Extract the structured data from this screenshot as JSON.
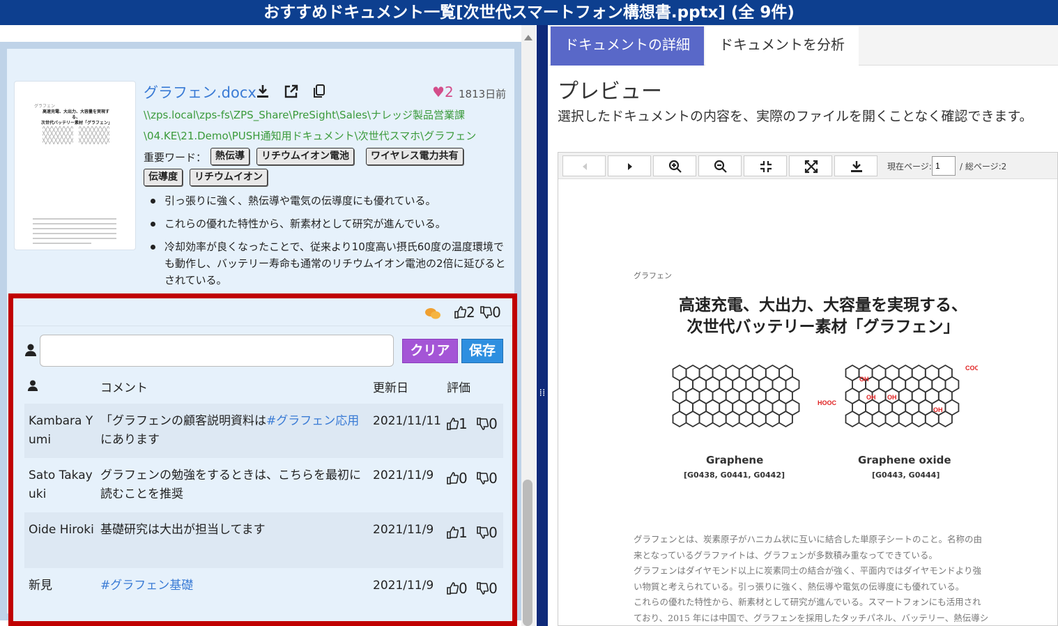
{
  "window": {
    "title": "おすすめドキュメント一覧[次世代スマートフォン構想書.pptx] (全 9件)"
  },
  "document": {
    "title": "グラフェン.docx",
    "likes": "2",
    "age": "1813日前",
    "path_line1": "\\\\zps.local\\zps-fs\\ZPS_Share\\PreSight\\Sales\\ナレッジ製品営業課",
    "path_line2": "\\04.KE\\21.Demo\\PUSH通知用ドキュメント\\次世代スマホ\\グラフェン",
    "keywords_label": "重要ワード：",
    "keywords": [
      "熱伝導",
      "リチウムイオン電池",
      "ワイヤレス電力共有",
      "伝導度",
      "リチウムイオン"
    ],
    "bullets": [
      "引っ張りに強く、熱伝導や電気の伝導度にも優れている。",
      "これらの優れた特性から、新素材として研究が進んでいる。",
      "冷却効率が良くなったことで、従来より10度高い摂氏60度の温度環境でも動作し、バッテリー寿命も通常のリチウムイオン電池の2倍に延びるとされている。"
    ],
    "thumbnail": {
      "header": "グラフェン",
      "title_line1": "高速充電、大出力、大容量を実現する、",
      "title_line2": "次世代バッテリー素材「グラフェン」"
    }
  },
  "comments_panel": {
    "good_count": "2",
    "bad_count": "0",
    "input_placeholder": "",
    "clear_label": "クリア",
    "save_label": "保存",
    "headers": {
      "comment": "コメント",
      "updated": "更新日",
      "rating": "評価"
    },
    "rows": [
      {
        "user": "Kambara Yumi",
        "text": "「グラフェンの顧客説明資料は",
        "link": "#グラフェン応用",
        "text_after": "にあります",
        "date": "2021/11/11",
        "good": "1",
        "bad": "0"
      },
      {
        "user": "Sato Takayuki",
        "text": "グラフェンの勉強をするときは、こちらを最初に読むことを推奨",
        "link": "",
        "text_after": "",
        "date": "2021/11/9",
        "good": "0",
        "bad": "0"
      },
      {
        "user": "Oide Hiroki",
        "text": "基礎研究は大出が担当してます",
        "link": "",
        "text_after": "",
        "date": "2021/11/9",
        "good": "1",
        "bad": "0"
      },
      {
        "user": "新見",
        "text": "",
        "link": "#グラフェン基礎",
        "text_after": "",
        "date": "2021/11/9",
        "good": "0",
        "bad": "0"
      }
    ]
  },
  "right": {
    "tabs": [
      {
        "label": "ドキュメントの詳細"
      },
      {
        "label": "ドキュメントを分析"
      }
    ],
    "preview_title": "プレビュー",
    "preview_desc": "選択したドキュメントの内容を、実際のファイルを開くことなく確認できます。",
    "toolbar": {
      "current_page_label": "現在ページ:",
      "current_page": "1",
      "total_label": "/ 総ページ:2"
    },
    "page": {
      "header": "グラフェン",
      "title_line1": "高速充電、大出力、大容量を実現する、",
      "title_line2": "次世代バッテリー素材「グラフェン」",
      "mol1_label": "Graphene",
      "mol1_code": "[G0438, G0441, G0442]",
      "mol2_label": "Graphene oxide",
      "mol2_code": "[G0443, G0444]",
      "body": [
        "グラフェンとは、炭素原子がハニカム状に互いに結合した単原子シートのこと。名称の由",
        "来となっているグラファイトは、グラフェンが多数積み重なってできている。",
        "グラフェンはダイヤモンド以上に炭素同士の結合が強く、平面内ではダイヤモンドより強",
        "い物質と考えられている。引っ張りに強く、熱伝導や電気の伝導度にも優れている。",
        "これらの優れた特性から、新素材として研究が進んでいる。スマートフォンにも活用され",
        "ており、2015 年には中国で、グラフェンを採用したタッチパネル、バッテリー、熱伝導シ"
      ]
    }
  },
  "colors": {
    "titlebar": "#0d3f8f",
    "accent_tab": "#5968c8",
    "highlight_border": "#c00000",
    "clear_button": "#a455d6",
    "save_button": "#2e8fe0",
    "link": "#3a7bd5",
    "path": "#3a9a3a",
    "heart": "#d34d8a"
  }
}
